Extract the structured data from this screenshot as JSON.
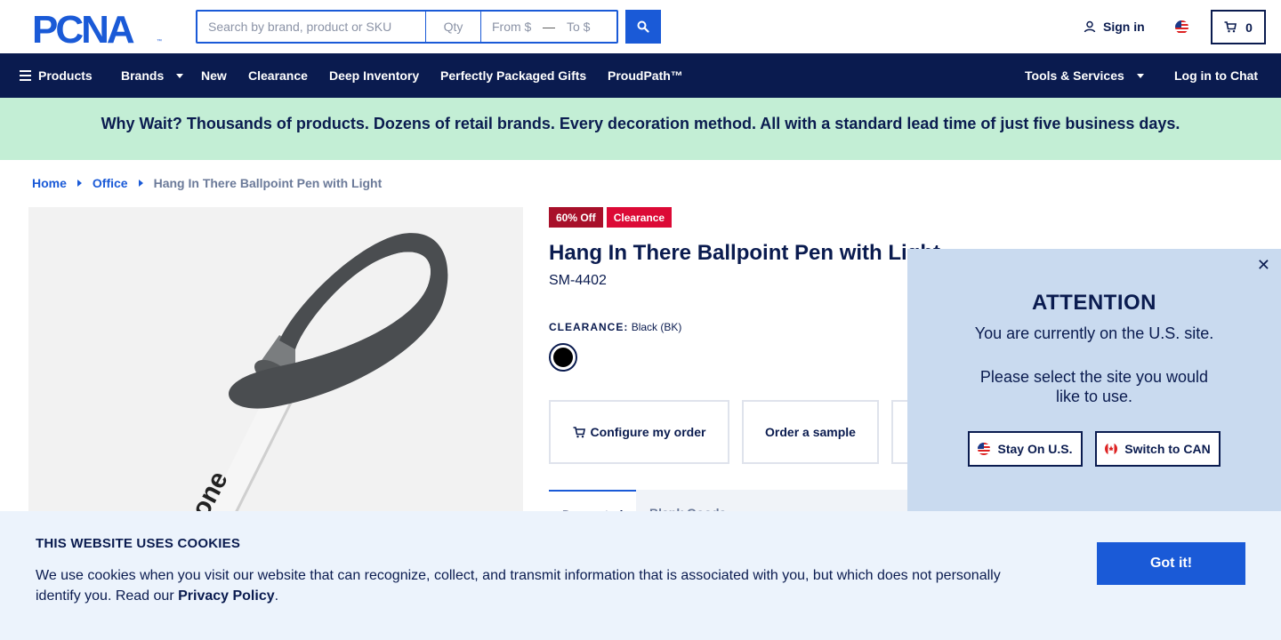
{
  "header": {
    "logo_text": "PCNA",
    "search": {
      "keyword_placeholder": "Search by brand, product or SKU",
      "qty_placeholder": "Qty",
      "from_placeholder": "From $",
      "price_dash": "—",
      "to_placeholder": "To $"
    },
    "sign_in_label": "Sign in",
    "cart_count": "0"
  },
  "nav": {
    "products": "Products",
    "brands": "Brands",
    "new": "New",
    "clearance": "Clearance",
    "deep_inventory": "Deep Inventory",
    "gifts": "Perfectly Packaged Gifts",
    "proudpath": "ProudPath™",
    "tools": "Tools & Services",
    "chat": "Log in to Chat"
  },
  "banner": {
    "text": "Why Wait? Thousands of products. Dozens of retail brands. Every decoration method. All with a standard lead time of just five business days."
  },
  "breadcrumb": {
    "home": "Home",
    "category": "Office",
    "current": "Hang In There Ballpoint Pen with Light"
  },
  "product": {
    "badge_discount": "60% Off",
    "badge_clearance": "Clearance",
    "title": "Hang In There Ballpoint Pen with Light",
    "sku": "SM-4402",
    "color_key": "CLEARANCE:",
    "color_value": "Black (BK)",
    "swatch_color": "#000000",
    "configure_label": "Configure my order",
    "sample_label": "Order a sample",
    "tab_active": "Decorated",
    "tab_other": "Blank Goods"
  },
  "popup": {
    "title": "ATTENTION",
    "line1": "You are currently on the U.S. site.",
    "line2": "Please select the site you would",
    "line3": "like to use.",
    "stay_label": "Stay On U.S.",
    "switch_label": "Switch to CAN"
  },
  "cookie": {
    "title": "THIS WEBSITE USES COOKIES",
    "text_before": "We use cookies when you visit our website that can recognize, collect, and transmit information that is associated with you, but which does not personally identify you. Read our ",
    "link": "Privacy Policy",
    "text_after": ".",
    "button": "Got it!"
  },
  "colors": {
    "navy": "#0a1b4f",
    "brand_blue": "#1a5ad7",
    "banner_green": "#c3eed5",
    "badge_red": "#dc0a36",
    "badge_dark_red": "#a8102a"
  }
}
